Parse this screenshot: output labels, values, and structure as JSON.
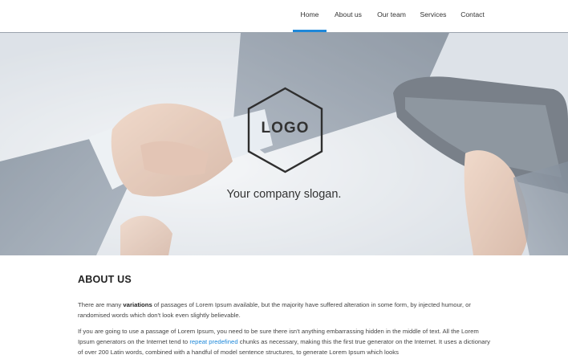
{
  "nav": {
    "items": [
      {
        "label": "Home",
        "active": true
      },
      {
        "label": "About us",
        "active": false
      },
      {
        "label": "Our team",
        "active": false
      },
      {
        "label": "Services",
        "active": false
      },
      {
        "label": "Contact",
        "active": false
      }
    ]
  },
  "hero": {
    "logo_text": "LOGO",
    "slogan": "Your company slogan."
  },
  "about": {
    "title": "ABOUT US",
    "p1_before": "There are many ",
    "p1_bold": "variations",
    "p1_after": " of passages of Lorem Ipsum available, but the majority have suffered alteration in some form, by injected humour, or randomised words which don't look even slightly believable.",
    "p2_before": "If you are going to use a passage of Lorem Ipsum, you need to be sure there isn't anything embarrassing hidden in the middle of text. All the Lorem Ipsum generators on the Internet tend to ",
    "p2_link": "repeat predefined",
    "p2_after": " chunks as necessary, making this the first true generator on the Internet. It uses a dictionary of over 200 Latin words, combined with a handful of model sentence structures, to generate Lorem Ipsum which looks"
  },
  "colors": {
    "accent": "#1e88d9",
    "text": "#333333",
    "hero_overlay": "#d9dee4"
  }
}
